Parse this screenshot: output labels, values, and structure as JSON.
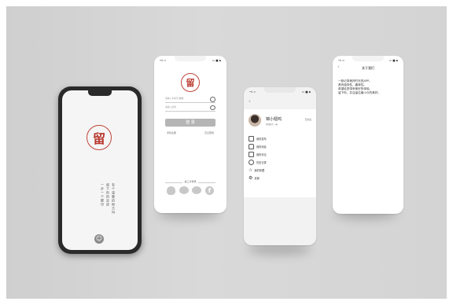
{
  "screen1": {
    "seal_char": "留",
    "tagline_1": "有个温暖的地方叫",
    "tagline_2": "留下你的足迹",
    "tagline_3": "一步一个脚印",
    "avatar_icon": "user-icon"
  },
  "screen2": {
    "status_left": "•ıl ≈",
    "status_right": "▭ ■ ▪",
    "seal_char": "留",
    "account_placeholder": "请输入手机号/邮箱",
    "password_placeholder": "请输入密码",
    "login_label": "登 录",
    "register_link": "手机注册",
    "forgot_link": "忘记密码",
    "third_party_label": "第三方登录",
    "icons": [
      "qq-icon",
      "wechat-icon",
      "weibo-icon",
      "facebook-icon"
    ]
  },
  "screen3": {
    "back_icon": "back-icon",
    "username": "锦小翅鸡",
    "subtitle": "已经来了一天",
    "badge": "已关注",
    "menu": [
      {
        "label": "我的发布",
        "icon": "edit-icon"
      },
      {
        "label": "我的消息",
        "icon": "bell-icon"
      },
      {
        "label": "我的评论",
        "icon": "comment-icon"
      },
      {
        "label": "历史记录",
        "icon": "clock-icon"
      },
      {
        "label": "我的收藏",
        "icon": "star-icon"
      },
      {
        "label": "设置",
        "icon": "gear-icon"
      }
    ]
  },
  "screen4": {
    "title": "关于我们",
    "line1": "一款记录美好时光的APP。",
    "line2": "具有独特性、趣味性。",
    "line3": "希望给您带来美好的体验。",
    "line4": "留下你，并且留住最小众的美好。"
  }
}
